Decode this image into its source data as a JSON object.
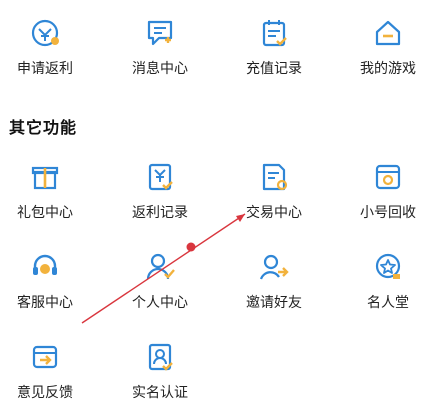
{
  "top_row": [
    {
      "label": "申请返利",
      "icon": "rebate-coin-icon"
    },
    {
      "label": "消息中心",
      "icon": "message-icon"
    },
    {
      "label": "充值记录",
      "icon": "recharge-record-icon"
    },
    {
      "label": "我的游戏",
      "icon": "home-icon"
    }
  ],
  "section_title": "其它功能",
  "grid": [
    {
      "label": "礼包中心",
      "icon": "gift-icon"
    },
    {
      "label": "返利记录",
      "icon": "rebate-record-icon"
    },
    {
      "label": "交易中心",
      "icon": "trade-icon"
    },
    {
      "label": "小号回收",
      "icon": "recycle-box-icon"
    },
    {
      "label": "客服中心",
      "icon": "headset-icon"
    },
    {
      "label": "个人中心",
      "icon": "person-icon"
    },
    {
      "label": "邀请好友",
      "icon": "invite-icon"
    },
    {
      "label": "名人堂",
      "icon": "star-badge-icon"
    },
    {
      "label": "意见反馈",
      "icon": "feedback-icon"
    },
    {
      "label": "实名认证",
      "icon": "id-card-icon"
    }
  ],
  "colors": {
    "primary": "#2f86d6",
    "accent": "#f2b23c",
    "annotation": "#d9363e"
  }
}
